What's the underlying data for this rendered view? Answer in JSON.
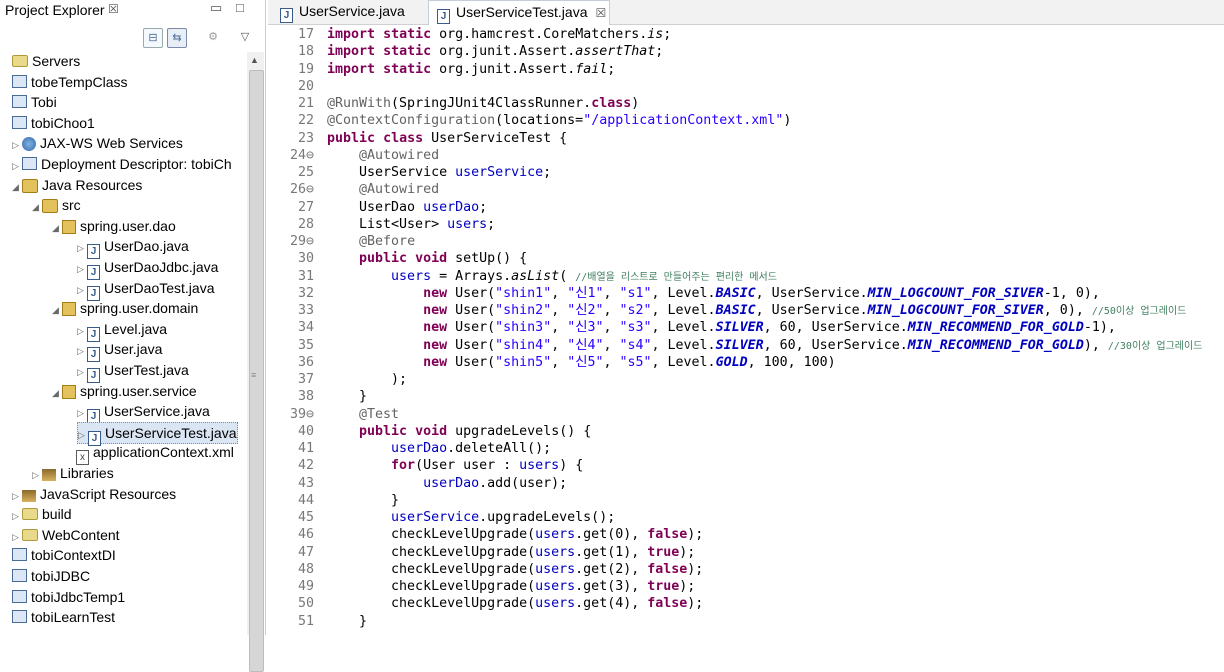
{
  "explorer": {
    "title": "Project Explorer",
    "close_glyph": "☒",
    "items": [
      {
        "label": "Servers",
        "icon": "folder-icon"
      },
      {
        "label": "tobeTempClass",
        "icon": "project-icon"
      },
      {
        "label": "Tobi",
        "icon": "project-icon"
      },
      {
        "label": "tobiChoo1",
        "icon": "java-project-icon"
      },
      {
        "label": "JAX-WS Web Services",
        "icon": "webservice-icon"
      },
      {
        "label": "Deployment Descriptor: tobiCh",
        "icon": "descriptor-icon"
      },
      {
        "label": "Java Resources",
        "icon": "java-resources-icon"
      },
      {
        "label": "src",
        "icon": "source-folder-icon"
      },
      {
        "label": "spring.user.dao",
        "icon": "package-icon"
      },
      {
        "label": "UserDao.java",
        "icon": "java-file-icon"
      },
      {
        "label": "UserDaoJdbc.java",
        "icon": "java-file-icon"
      },
      {
        "label": "UserDaoTest.java",
        "icon": "java-file-icon"
      },
      {
        "label": "spring.user.domain",
        "icon": "package-icon"
      },
      {
        "label": "Level.java",
        "icon": "java-file-icon"
      },
      {
        "label": "User.java",
        "icon": "java-file-icon"
      },
      {
        "label": "UserTest.java",
        "icon": "java-file-icon"
      },
      {
        "label": "spring.user.service",
        "icon": "package-icon"
      },
      {
        "label": "UserService.java",
        "icon": "java-file-icon"
      },
      {
        "label": "UserServiceTest.java",
        "icon": "java-file-icon"
      },
      {
        "label": "applicationContext.xml",
        "icon": "xml-file-icon"
      },
      {
        "label": "Libraries",
        "icon": "library-icon"
      },
      {
        "label": "JavaScript Resources",
        "icon": "js-resources-icon"
      },
      {
        "label": "build",
        "icon": "folder-icon"
      },
      {
        "label": "WebContent",
        "icon": "folder-icon"
      },
      {
        "label": "tobiContextDI",
        "icon": "project-icon"
      },
      {
        "label": "tobiJDBC",
        "icon": "project-icon"
      },
      {
        "label": "tobiJdbcTemp1",
        "icon": "java-project-icon"
      },
      {
        "label": "tobiLearnTest",
        "icon": "project-icon"
      }
    ]
  },
  "editor": {
    "tabs": [
      {
        "label": "UserService.java"
      },
      {
        "label": "UserServiceTest.java",
        "close": "☒"
      }
    ],
    "lines": [
      {
        "n": "17",
        "text": "import static org.hamcrest.CoreMatchers.is;"
      },
      {
        "n": "18",
        "text": "import static org.junit.Assert.assertThat;"
      },
      {
        "n": "19",
        "text": "import static org.junit.Assert.fail;"
      },
      {
        "n": "20",
        "text": ""
      },
      {
        "n": "21",
        "text": "@RunWith(SpringJUnit4ClassRunner.class)"
      },
      {
        "n": "22",
        "text": "@ContextConfiguration(locations=\"/applicationContext.xml\")"
      },
      {
        "n": "23",
        "text": "public class UserServiceTest {"
      },
      {
        "n": "24⊖",
        "text": "    @Autowired"
      },
      {
        "n": "25",
        "text": "    UserService userService;"
      },
      {
        "n": "26⊖",
        "text": "    @Autowired"
      },
      {
        "n": "27",
        "text": "    UserDao userDao;"
      },
      {
        "n": "28",
        "text": "    List<User> users;"
      },
      {
        "n": "29⊖",
        "text": "    @Before"
      },
      {
        "n": "30",
        "text": "    public void setUp() {"
      },
      {
        "n": "31",
        "text": "        users = Arrays.asList( //배열을 리스트로 만들어주는 편리한 메서드"
      },
      {
        "n": "32",
        "text": "            new User(\"shin1\", \"신1\", \"s1\", Level.BASIC, UserService.MIN_LOGCOUNT_FOR_SIVER-1, 0),"
      },
      {
        "n": "33",
        "text": "            new User(\"shin2\", \"신2\", \"s2\", Level.BASIC, UserService.MIN_LOGCOUNT_FOR_SIVER, 0), //50이상 업그레이드"
      },
      {
        "n": "34",
        "text": "            new User(\"shin3\", \"신3\", \"s3\", Level.SILVER, 60, UserService.MIN_RECOMMEND_FOR_GOLD-1),"
      },
      {
        "n": "35",
        "text": "            new User(\"shin4\", \"신4\", \"s4\", Level.SILVER, 60, UserService.MIN_RECOMMEND_FOR_GOLD), //30이상 업그레이드"
      },
      {
        "n": "36",
        "text": "            new User(\"shin5\", \"신5\", \"s5\", Level.GOLD, 100, 100)"
      },
      {
        "n": "37",
        "text": "        );"
      },
      {
        "n": "38",
        "text": "    }"
      },
      {
        "n": "39⊖",
        "text": "    @Test"
      },
      {
        "n": "40",
        "text": "    public void upgradeLevels() {"
      },
      {
        "n": "41",
        "text": "        userDao.deleteAll();"
      },
      {
        "n": "42",
        "text": "        for(User user : users) {"
      },
      {
        "n": "43",
        "text": "            userDao.add(user);"
      },
      {
        "n": "44",
        "text": "        }"
      },
      {
        "n": "45",
        "text": "        userService.upgradeLevels();"
      },
      {
        "n": "46",
        "text": "        checkLevelUpgrade(users.get(0), false);"
      },
      {
        "n": "47",
        "text": "        checkLevelUpgrade(users.get(1), true);"
      },
      {
        "n": "48",
        "text": "        checkLevelUpgrade(users.get(2), false);"
      },
      {
        "n": "49",
        "text": "        checkLevelUpgrade(users.get(3), true);"
      },
      {
        "n": "50",
        "text": "        checkLevelUpgrade(users.get(4), false);"
      },
      {
        "n": "51",
        "text": "    }"
      }
    ]
  }
}
